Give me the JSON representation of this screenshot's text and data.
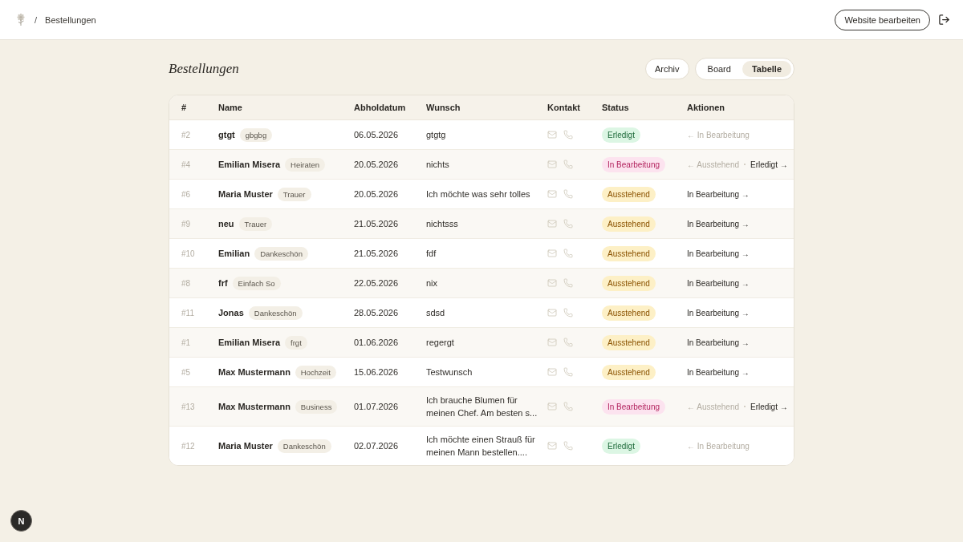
{
  "header": {
    "breadcrumb_separator": "/",
    "breadcrumb_current": "Bestellungen",
    "edit_button": "Website bearbeiten"
  },
  "page": {
    "title": "Bestellungen",
    "archive_button": "Archiv",
    "views": [
      {
        "label": "Board",
        "selected": false
      },
      {
        "label": "Tabelle",
        "selected": true
      }
    ]
  },
  "table": {
    "columns": [
      "#",
      "Name",
      "Abholdatum",
      "Wunsch",
      "Kontakt",
      "Status",
      "Aktionen"
    ],
    "rows": [
      {
        "id": "#2",
        "name": "gtgt",
        "tag": "gbgbg",
        "date": "06.05.2026",
        "wish": "gtgtg",
        "status": {
          "label": "Erledigt",
          "kind": "done"
        },
        "actions": [
          {
            "label": "← In Bearbeitung",
            "kind": "back"
          }
        ]
      },
      {
        "id": "#4",
        "name": "Emilian Misera",
        "tag": "Heiraten",
        "date": "20.05.2026",
        "wish": "nichts",
        "status": {
          "label": "In Bearbeitung",
          "kind": "progress"
        },
        "actions": [
          {
            "label": "← Ausstehend",
            "kind": "back"
          },
          {
            "label": "Erledigt →",
            "kind": "forward"
          }
        ]
      },
      {
        "id": "#6",
        "name": "Maria Muster",
        "tag": "Trauer",
        "date": "20.05.2026",
        "wish": "Ich möchte was sehr tolles",
        "status": {
          "label": "Ausstehend",
          "kind": "pending"
        },
        "actions": [
          {
            "label": "In Bearbeitung →",
            "kind": "forward"
          }
        ]
      },
      {
        "id": "#9",
        "name": "neu",
        "tag": "Trauer",
        "date": "21.05.2026",
        "wish": "nichtsss",
        "status": {
          "label": "Ausstehend",
          "kind": "pending"
        },
        "actions": [
          {
            "label": "In Bearbeitung →",
            "kind": "forward"
          }
        ]
      },
      {
        "id": "#10",
        "name": "Emilian",
        "tag": "Dankeschön",
        "date": "21.05.2026",
        "wish": "fdf",
        "status": {
          "label": "Ausstehend",
          "kind": "pending"
        },
        "actions": [
          {
            "label": "In Bearbeitung →",
            "kind": "forward"
          }
        ]
      },
      {
        "id": "#8",
        "name": "frf",
        "tag": "Einfach So",
        "date": "22.05.2026",
        "wish": "nix",
        "status": {
          "label": "Ausstehend",
          "kind": "pending"
        },
        "actions": [
          {
            "label": "In Bearbeitung →",
            "kind": "forward"
          }
        ]
      },
      {
        "id": "#11",
        "name": "Jonas",
        "tag": "Dankeschön",
        "date": "28.05.2026",
        "wish": "sdsd",
        "status": {
          "label": "Ausstehend",
          "kind": "pending"
        },
        "actions": [
          {
            "label": "In Bearbeitung →",
            "kind": "forward"
          }
        ]
      },
      {
        "id": "#1",
        "name": "Emilian Misera",
        "tag": "frgt",
        "date": "01.06.2026",
        "wish": "regergt",
        "status": {
          "label": "Ausstehend",
          "kind": "pending"
        },
        "actions": [
          {
            "label": "In Bearbeitung →",
            "kind": "forward"
          }
        ]
      },
      {
        "id": "#5",
        "name": "Max Mustermann",
        "tag": "Hochzeit",
        "date": "15.06.2026",
        "wish": "Testwunsch",
        "status": {
          "label": "Ausstehend",
          "kind": "pending"
        },
        "actions": [
          {
            "label": "In Bearbeitung →",
            "kind": "forward"
          }
        ]
      },
      {
        "id": "#13",
        "name": "Max Mustermann",
        "tag": "Business",
        "date": "01.07.2026",
        "wish": "Ich brauche Blumen für meinen Chef. Am besten s...",
        "status": {
          "label": "In Bearbeitung",
          "kind": "progress"
        },
        "actions": [
          {
            "label": "← Ausstehend",
            "kind": "back"
          },
          {
            "label": "Erledigt →",
            "kind": "forward"
          }
        ]
      },
      {
        "id": "#12",
        "name": "Maria Muster",
        "tag": "Dankeschön",
        "date": "02.07.2026",
        "wish": "Ich möchte einen Strauß für meinen Mann bestellen....",
        "status": {
          "label": "Erledigt",
          "kind": "done"
        },
        "actions": [
          {
            "label": "← In Bearbeitung",
            "kind": "back"
          }
        ]
      }
    ]
  },
  "dev_badge": "N"
}
